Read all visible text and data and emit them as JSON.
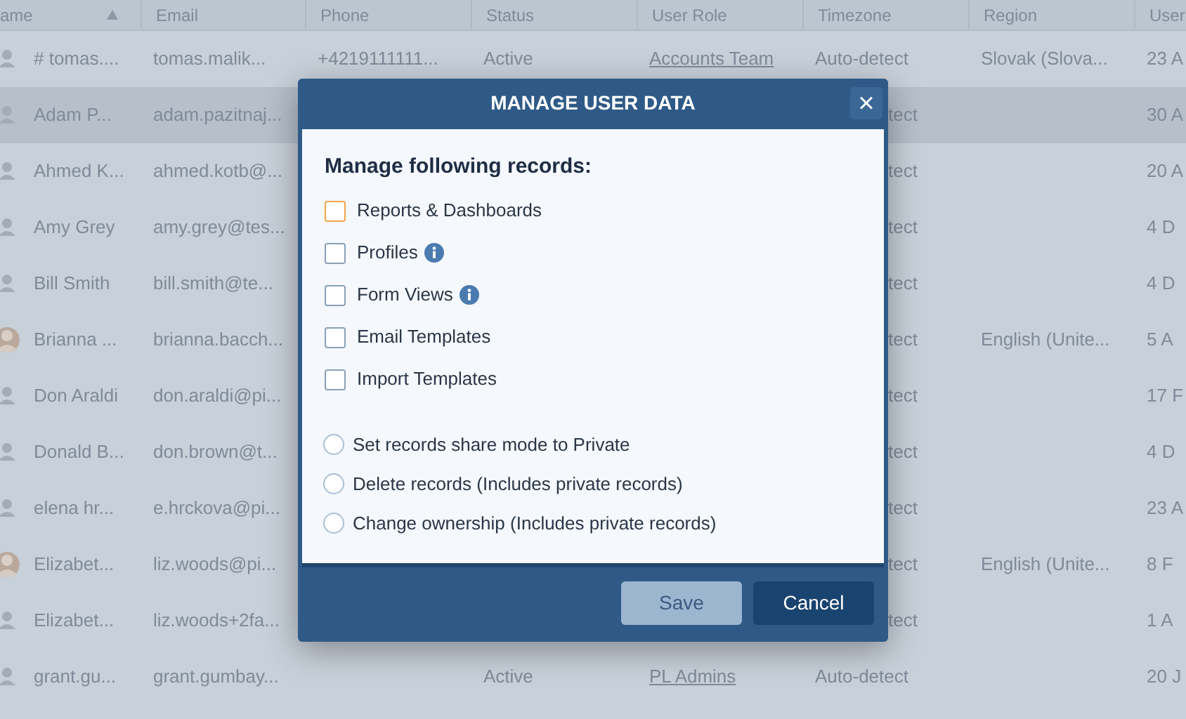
{
  "table": {
    "columns": [
      {
        "label": "ame",
        "sorted": true
      },
      {
        "label": "Email",
        "sorted": false
      },
      {
        "label": "Phone",
        "sorted": false
      },
      {
        "label": "Status",
        "sorted": false
      },
      {
        "label": "User Role",
        "sorted": false
      },
      {
        "label": "Timezone",
        "sorted": false
      },
      {
        "label": "Region",
        "sorted": false
      },
      {
        "label": "User",
        "sorted": false
      }
    ],
    "rows": [
      {
        "kind": "silhouette",
        "hovered": false,
        "name": "# tomas....",
        "email": "tomas.malik...",
        "phone": "+4219111111...",
        "status": "Active",
        "role": "Accounts Team",
        "timezone": "Auto-detect",
        "region": "Slovak (Slova...",
        "date": "23 A"
      },
      {
        "kind": "silhouette",
        "hovered": true,
        "name": "Adam P...",
        "email": "adam.pazitnaj...",
        "timezone": "tect",
        "date": "30 A"
      },
      {
        "kind": "silhouette",
        "hovered": false,
        "name": "Ahmed K...",
        "email": "ahmed.kotb@...",
        "timezone": "tect",
        "date": "20 A"
      },
      {
        "kind": "silhouette",
        "hovered": false,
        "name": "Amy Grey",
        "email": "amy.grey@tes...",
        "timezone": "tect",
        "date": "4 D"
      },
      {
        "kind": "silhouette",
        "hovered": false,
        "name": "Bill Smith",
        "email": "bill.smith@te...",
        "timezone": "tect",
        "date": "4 D"
      },
      {
        "hovered": false,
        "name": "Brianna ...",
        "email": "brianna.bacch...",
        "timezone": "tect",
        "region": "English (Unite...",
        "date": "5 A"
      },
      {
        "kind": "silhouette",
        "hovered": false,
        "name": "Don Araldi",
        "email": "don.araldi@pi...",
        "timezone": "tect",
        "date": "17 F"
      },
      {
        "kind": "silhouette",
        "hovered": false,
        "name": "Donald B...",
        "email": "don.brown@t...",
        "timezone": "tect",
        "date": "4 D"
      },
      {
        "kind": "silhouette",
        "hovered": false,
        "name": "elena hr...",
        "email": "e.hrckova@pi...",
        "timezone": "tect",
        "date": "23 A"
      },
      {
        "hovered": false,
        "name": "Elizabet...",
        "email": "liz.woods@pi...",
        "timezone": "tect",
        "region": "English (Unite...",
        "date": "8 F"
      },
      {
        "kind": "silhouette",
        "hovered": false,
        "name": "Elizabet...",
        "email": "liz.woods+2fa...",
        "timezone": "tect",
        "date": "1 A"
      },
      {
        "kind": "silhouette",
        "hovered": false,
        "name": "grant.gu...",
        "email": "grant.gumbay...",
        "status": "Active",
        "role": "PL Admins",
        "timezone": "Auto-detect",
        "date": "20 J"
      }
    ]
  },
  "dialog": {
    "title": "MANAGE USER DATA",
    "close": "×",
    "heading": "Manage following records:",
    "checkboxes": [
      {
        "label": "Reports & Dashboards",
        "checked": false,
        "focused": true,
        "info": false
      },
      {
        "label": "Profiles",
        "checked": false,
        "focused": false,
        "info": true
      },
      {
        "label": "Form Views",
        "checked": false,
        "focused": false,
        "info": true
      },
      {
        "label": "Email Templates",
        "checked": false,
        "focused": false,
        "info": false
      },
      {
        "label": "Import Templates",
        "checked": false,
        "focused": false,
        "info": false
      }
    ],
    "radios": [
      {
        "label": "Set records share mode to Private",
        "selected": false
      },
      {
        "label": "Delete records (Includes private records)",
        "selected": false
      },
      {
        "label": "Change ownership (Includes private records)",
        "selected": false
      }
    ],
    "buttons": [
      {
        "label": "Save",
        "kind": "secondary"
      },
      {
        "label": "Cancel",
        "kind": "primary"
      }
    ]
  }
}
